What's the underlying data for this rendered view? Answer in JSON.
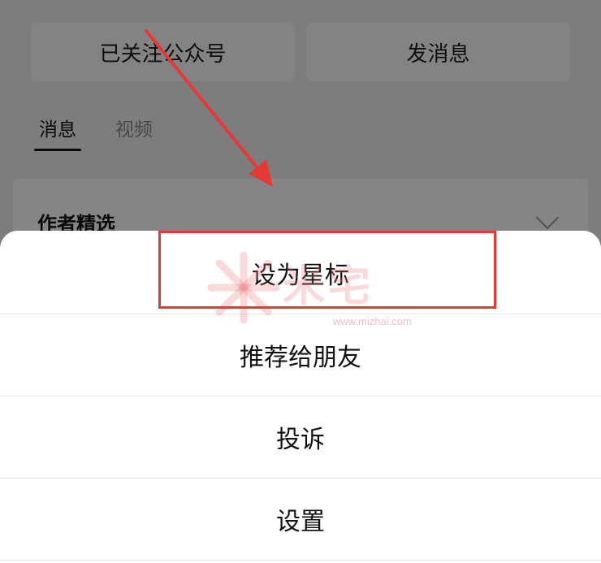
{
  "background": {
    "buttons": {
      "followed": "已关注公众号",
      "message": "发消息"
    },
    "tabs": [
      {
        "label": "消息",
        "active": true
      },
      {
        "label": "视频",
        "active": false
      }
    ],
    "card": {
      "title": "作者精选"
    }
  },
  "sheet": {
    "items": [
      {
        "label": "设为星标",
        "highlighted": true
      },
      {
        "label": "推荐给朋友"
      },
      {
        "label": "投诉"
      },
      {
        "label": "设置"
      }
    ]
  },
  "watermark": {
    "text": "米宅",
    "url": "www.mizhai.com"
  },
  "colors": {
    "annotation": "#e53935",
    "sheet_bg": "#ffffff",
    "overlay": "rgba(0,0,0,0.47)"
  }
}
